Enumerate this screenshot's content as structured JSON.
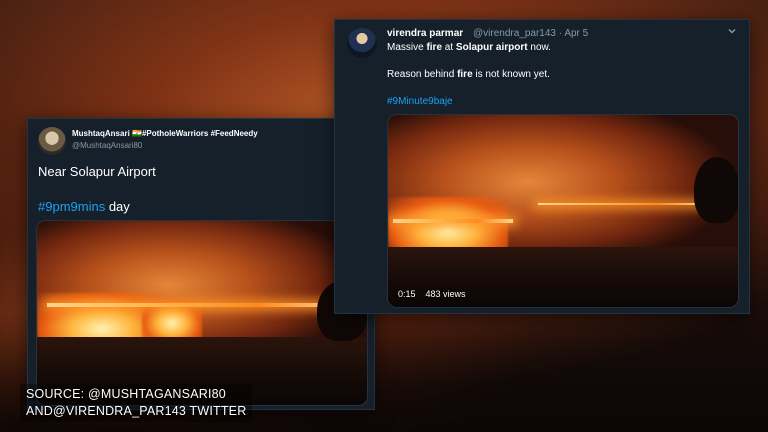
{
  "tweet_left": {
    "author_name": "MushtaqAnsari 🇮🇳#PotholeWarriors #FeedNeedy",
    "author_handle": "@MushtaqAnsari80",
    "text_line1": "Near Solapur Airport",
    "hashtag": "#9pm9mins",
    "text_after_hashtag": " day"
  },
  "tweet_right": {
    "author_name": "virendra parmar",
    "author_handle": "@virendra_par143",
    "separator": " · ",
    "date": "Apr 5",
    "line1_pre": "Massive ",
    "line1_em1": "fire",
    "line1_mid": " at ",
    "line1_em2": "Solapur airport",
    "line1_post": " now.",
    "line2_pre": "Reason behind ",
    "line2_em": "fire",
    "line2_post": " is not known yet.",
    "hashtag": "#9Minute9baje",
    "video_time": "0:15",
    "video_views": "483 views"
  },
  "caption": {
    "line1": "SOURCE: @MUSHTAGANSARI80",
    "line2": "AND@VIRENDRA_PAR143 TWITTER"
  },
  "icons": {
    "menu": "chevron-down-icon"
  },
  "colors": {
    "tweet_bg": "#15202b",
    "link": "#1da1f2",
    "muted": "#8899a6"
  }
}
